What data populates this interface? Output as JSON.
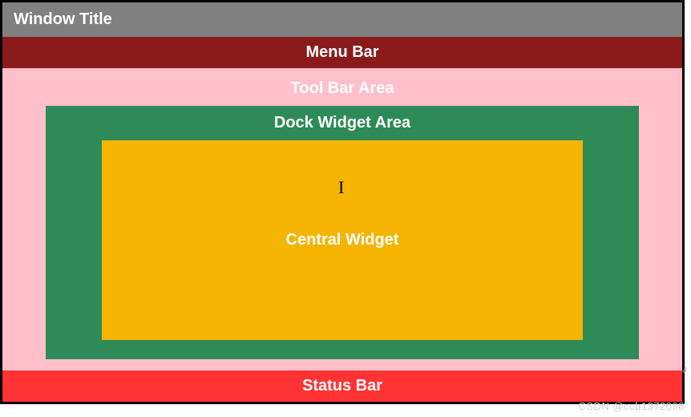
{
  "window": {
    "title": "Window Title"
  },
  "menu_bar": {
    "label": "Menu Bar"
  },
  "tool_bar": {
    "label": "Tool Bar Area"
  },
  "dock_area": {
    "label": "Dock Widget Area"
  },
  "central_widget": {
    "label": "Central Widget"
  },
  "status_bar": {
    "label": "Status Bar"
  },
  "watermark": "CSDN @ccb1372098",
  "colors": {
    "title_bar": "#808080",
    "menu_bar": "#8B1A1A",
    "tool_bar": "#FFC0CB",
    "dock_area": "#2E8B57",
    "central_widget": "#F4B400",
    "status_bar": "#FF3333"
  }
}
